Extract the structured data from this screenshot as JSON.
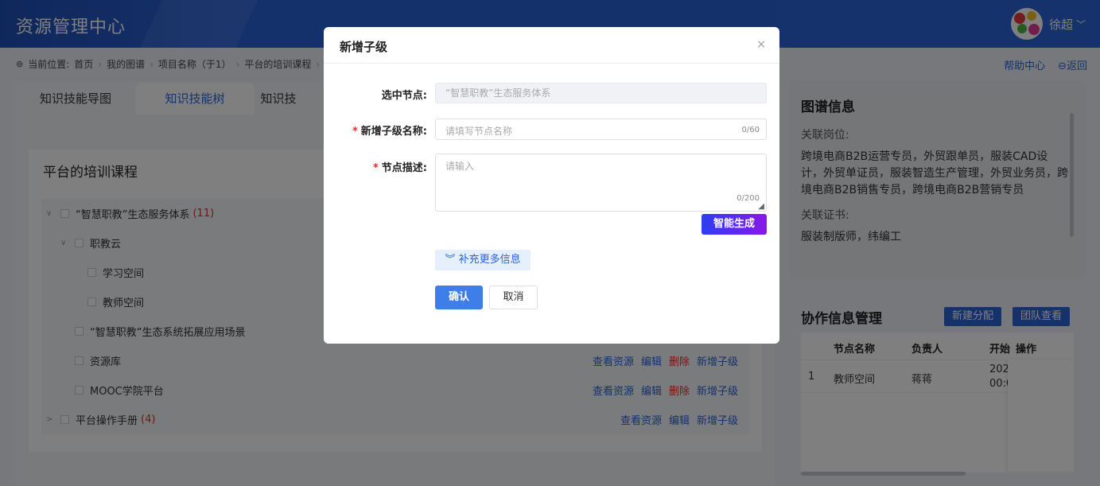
{
  "header": {
    "app_title": "资源管理中心",
    "user_name": "徐超",
    "user_dropdown": "﹀"
  },
  "breadcrumb": {
    "prefix": "当前位置:",
    "items": [
      "首页",
      "我的图谱",
      "项目名称（于1）",
      "平台的培训课程"
    ]
  },
  "toplinks": {
    "help": "帮助中心",
    "back": "返回"
  },
  "tabs": [
    "知识技能导图",
    "知识技能树",
    "知识技"
  ],
  "course_card": {
    "title": "平台的培训课程",
    "tree": [
      {
        "label": "“智慧职教”生态服务体系",
        "count": "(11)",
        "level": 0,
        "arrow": "∨"
      },
      {
        "label": "职教云",
        "count": "",
        "level": 1,
        "arrow": "∨"
      },
      {
        "label": "学习空间",
        "count": "",
        "level": 2,
        "arrow": ""
      },
      {
        "label": "教师空间",
        "count": "",
        "level": 2,
        "arrow": ""
      },
      {
        "label": "“智慧职教”生态系统拓展应用场景",
        "count": "",
        "level": 1,
        "arrow": ""
      },
      {
        "label": "资源库",
        "count": "",
        "level": 1,
        "arrow": ""
      },
      {
        "label": "MOOC学院平台",
        "count": "",
        "level": 1,
        "arrow": ""
      },
      {
        "label": "平台操作手册",
        "count": "(4)",
        "level": 0,
        "arrow": ">"
      }
    ],
    "actions": {
      "view": "查看资源",
      "edit": "编辑",
      "delete": "删除",
      "add_child": "新增子级"
    }
  },
  "graph_info": {
    "title": "图谱信息",
    "positions_label": "关联岗位:",
    "positions": "跨境电商B2B运营专员，外贸跟单员，服装CAD设计，外贸单证员，服装智造生产管理，外贸业务员，跨境电商B2B销售专员，跨境电商B2B营销专员",
    "certs_label": "关联证书:",
    "certs": "服装制版师，纬编工"
  },
  "collab": {
    "title": "协作信息管理",
    "new_assign": "新建分配",
    "team_view": "团队查看",
    "columns": [
      "节点名称",
      "负责人",
      "开始",
      "操作"
    ],
    "rows": [
      {
        "index": "1",
        "node": "教师空间",
        "owner": "蒋蒋",
        "start_line1": "202",
        "start_line2": "00:0"
      }
    ]
  },
  "dialog": {
    "title": "新增子级",
    "close": "×",
    "selected_label": "选中节点:",
    "selected_value": "“智慧职教”生态服务体系",
    "name_label": "新增子级名称:",
    "name_placeholder": "请填写节点名称",
    "name_counter": "0/60",
    "desc_label": "节点描述:",
    "desc_placeholder": "请输入",
    "desc_counter": "0/200",
    "required_mark": "*",
    "generate": "智能生成",
    "more_info": "补充更多信息",
    "confirm": "确认",
    "cancel": "取消"
  }
}
